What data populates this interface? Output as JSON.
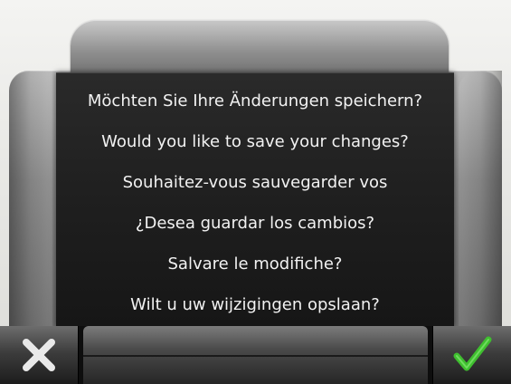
{
  "dialog": {
    "messages": [
      "Möchten Sie Ihre Änderungen speichern?",
      "Would you like to save your changes?",
      "Souhaitez-vous sauvegarder vos",
      "¿Desea guardar los cambios?",
      "Salvare le modifiche?",
      "Wilt u uw wijzigingen opslaan?"
    ]
  },
  "buttons": {
    "cancel": {
      "icon": "close-icon",
      "color": "#e9e9e9"
    },
    "confirm": {
      "icon": "checkmark-icon",
      "color": "#3fbf2f"
    }
  }
}
